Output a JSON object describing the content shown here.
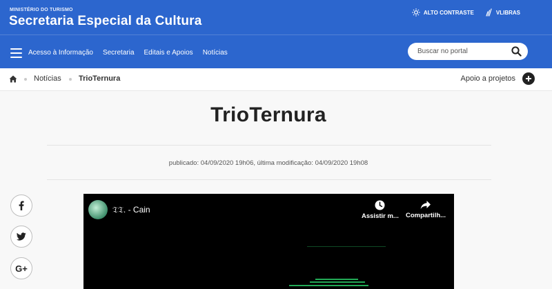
{
  "header": {
    "ministry": "MINISTÉRIO DO TURISMO",
    "site_title": "Secretaria Especial da Cultura",
    "contrast_label": "ALTO CONTRASTE",
    "vlibras_label": "VLIBRAS",
    "search_placeholder": "Buscar no portal"
  },
  "nav": {
    "items": [
      {
        "label": "Acesso à Informação"
      },
      {
        "label": "Secretaria"
      },
      {
        "label": "Editais e Apoios"
      },
      {
        "label": "Notícias"
      }
    ]
  },
  "breadcrumb": {
    "items": [
      {
        "label": "Notícias"
      },
      {
        "label": "TrioTernura"
      }
    ],
    "apoio_label": "Apoio a projetos"
  },
  "article": {
    "title": "TrioTernura",
    "meta": "publicado: 04/09/2020 19h06, última modificação: 04/09/2020 19h08"
  },
  "social": {
    "gplus_label": "G+"
  },
  "video": {
    "title": "𝔗𝔗. - Cain",
    "watch_later_label": "Assistir m...",
    "share_label": "Compartilh..."
  },
  "colors": {
    "header_bg": "#2c66ce",
    "page_bg": "#f8f8f8",
    "video_bg": "#000000"
  }
}
